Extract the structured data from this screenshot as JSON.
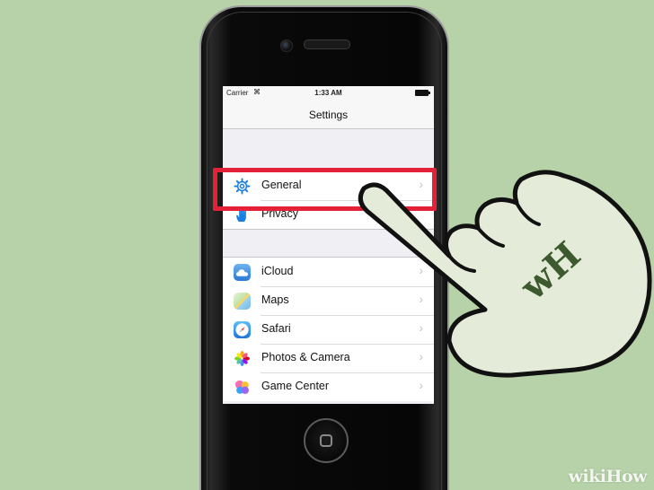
{
  "status_bar": {
    "carrier": "Carrier",
    "time": "1:33 AM"
  },
  "nav": {
    "title": "Settings"
  },
  "groups": [
    [
      {
        "label": "General",
        "icon": "gear-icon"
      },
      {
        "label": "Privacy",
        "icon": "hand-icon"
      }
    ],
    [
      {
        "label": "iCloud",
        "icon": "cloud-icon"
      },
      {
        "label": "Maps",
        "icon": "maps-icon"
      },
      {
        "label": "Safari",
        "icon": "compass-icon"
      },
      {
        "label": "Photos & Camera",
        "icon": "flower-icon"
      },
      {
        "label": "Game Center",
        "icon": "bubbles-icon"
      }
    ]
  ],
  "highlighted_item": "General",
  "watermark": {
    "badge": "wH",
    "logo": "wikiHow"
  },
  "colors": {
    "background": "#b7d2a8",
    "highlight": "#e5213a",
    "accent": "#1a7fe0"
  }
}
